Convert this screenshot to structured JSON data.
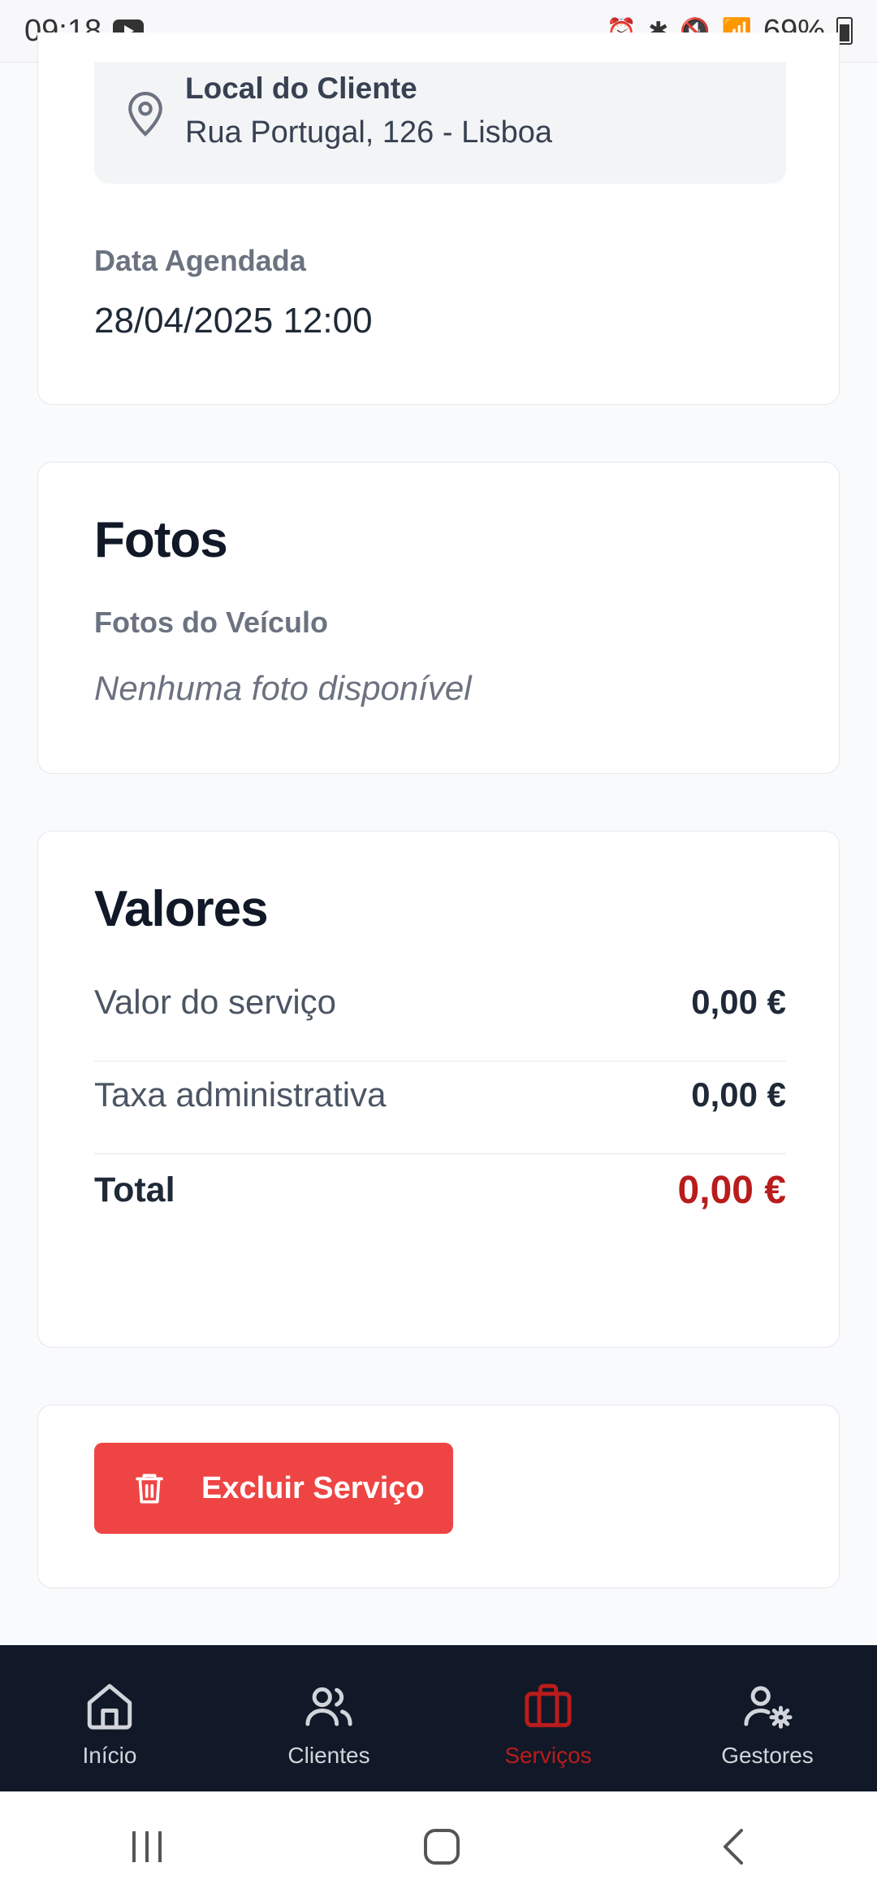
{
  "status_bar": {
    "time": "09:18",
    "battery": "69%"
  },
  "location": {
    "title": "Local do Cliente",
    "address": "Rua Portugal, 126 - Lisboa"
  },
  "schedule": {
    "label": "Data Agendada",
    "value": "28/04/2025 12:00"
  },
  "photos": {
    "title": "Fotos",
    "subtitle": "Fotos do Veículo",
    "empty_text": "Nenhuma foto disponível"
  },
  "values": {
    "title": "Valores",
    "rows": [
      {
        "label": "Valor do serviço",
        "value": "0,00 €"
      },
      {
        "label": "Taxa administrativa",
        "value": "0,00 €"
      }
    ],
    "total_label": "Total",
    "total_value": "0,00 €",
    "total_color": "#b91c1c"
  },
  "actions": {
    "delete_label": "Excluir Serviço"
  },
  "bottom_nav": {
    "items": [
      {
        "label": "Início",
        "icon": "home-icon",
        "active": false
      },
      {
        "label": "Clientes",
        "icon": "users-icon",
        "active": false
      },
      {
        "label": "Serviços",
        "icon": "briefcase-icon",
        "active": true
      },
      {
        "label": "Gestores",
        "icon": "user-gear-icon",
        "active": false
      }
    ]
  },
  "colors": {
    "accent": "#b91c1c",
    "danger_button": "#ef4444",
    "nav_background": "#111827"
  }
}
